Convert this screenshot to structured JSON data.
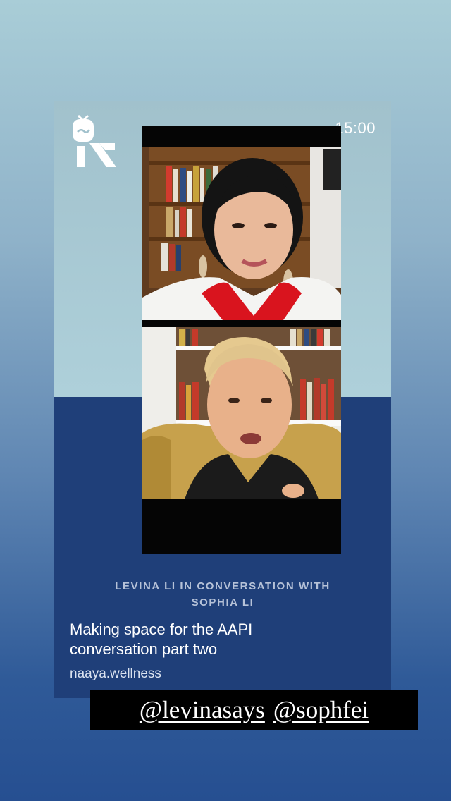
{
  "story": {
    "timestamp": "15:00",
    "caption": {
      "kicker_line1": "LEVINA LI IN CONVERSATION WITH",
      "kicker_line2": "SOPHIA LI",
      "title_line1": "Making space for the AAPI",
      "title_line2": "conversation part two",
      "handle": "naaya.wellness"
    },
    "mentions": [
      "@levinasays",
      "@sophfei"
    ]
  },
  "colors": {
    "card_top": "#aed0da",
    "card_bottom": "#1f3f79",
    "accent_red": "#d9141e"
  }
}
